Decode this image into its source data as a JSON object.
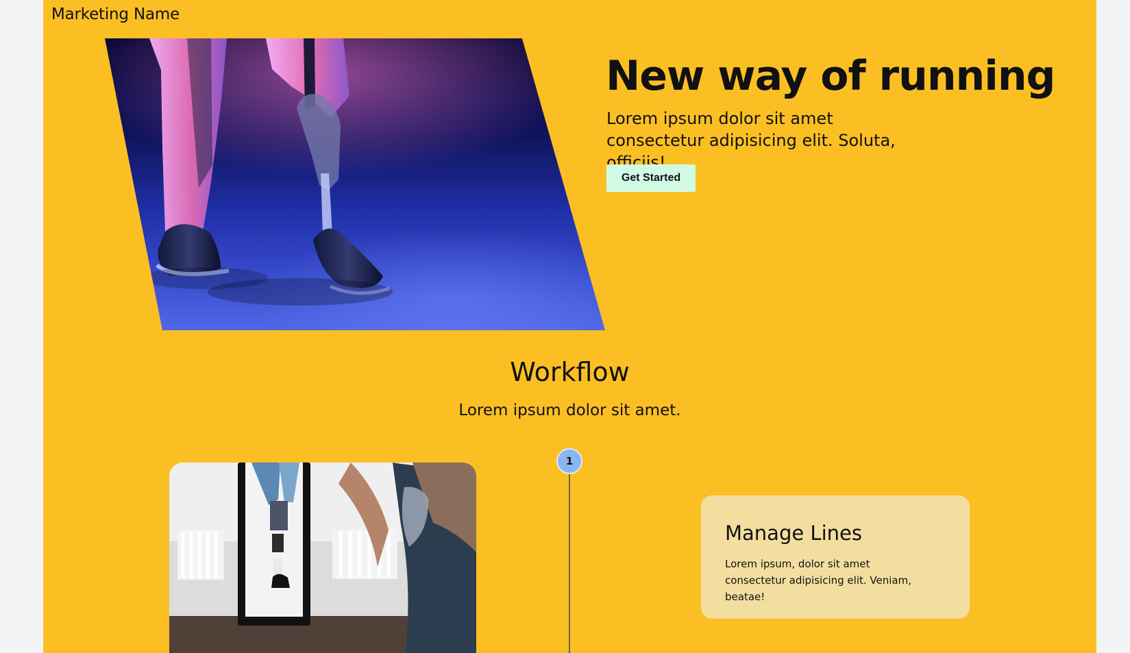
{
  "header": {
    "brand": "Marketing Name"
  },
  "hero": {
    "image_alt": "Runner with prosthetic leg tying shoe",
    "title": "New way of running",
    "description": "Lorem ipsum dolor sit amet consectetur adipisicing elit. Soluta, officiis!",
    "button_label": "Get Started"
  },
  "workflow": {
    "title": "Workflow",
    "subtitle": "Lorem ipsum dolor sit amet.",
    "steps": [
      {
        "number": "1",
        "image_alt": "Person tying shoe in front of mirror",
        "title": "Manage Lines",
        "description": "Lorem ipsum, dolor sit amet consectetur adipisicing elit. Veniam, beatae!"
      }
    ]
  },
  "colors": {
    "page_background": "#f3f4f6",
    "brand_yellow": "#fbbf24",
    "button_background": "#d1fae5",
    "step_badge": "#8ab6f0",
    "card_background": "#f3dea0",
    "timeline_line": "#5b6c3a"
  }
}
